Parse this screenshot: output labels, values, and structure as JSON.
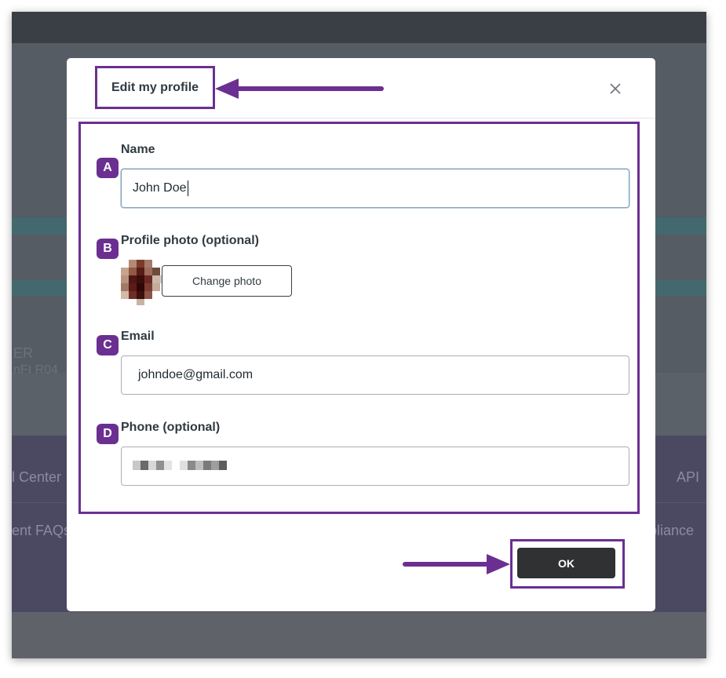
{
  "background": {
    "ghost_text": [
      "ER",
      "nFI R04"
    ],
    "links_row1": [
      "l Center",
      "API"
    ],
    "links_row2": [
      "ent FAQs",
      "pliance"
    ]
  },
  "modal": {
    "title": "Edit my profile",
    "close_icon": "close-icon",
    "ok_label": "OK"
  },
  "form": {
    "name": {
      "badge": "A",
      "label": "Name",
      "value": "John Doe"
    },
    "photo": {
      "badge": "B",
      "label": "Profile photo (optional)",
      "button_label": "Change photo"
    },
    "email": {
      "badge": "C",
      "label": "Email",
      "value": "johndoe@gmail.com"
    },
    "phone": {
      "badge": "D",
      "label": "Phone (optional)",
      "value_masked": true
    }
  },
  "colors": {
    "annotation_purple": "#6b2f91",
    "ok_button": "#2f3133",
    "backdrop": "#5b6169"
  }
}
